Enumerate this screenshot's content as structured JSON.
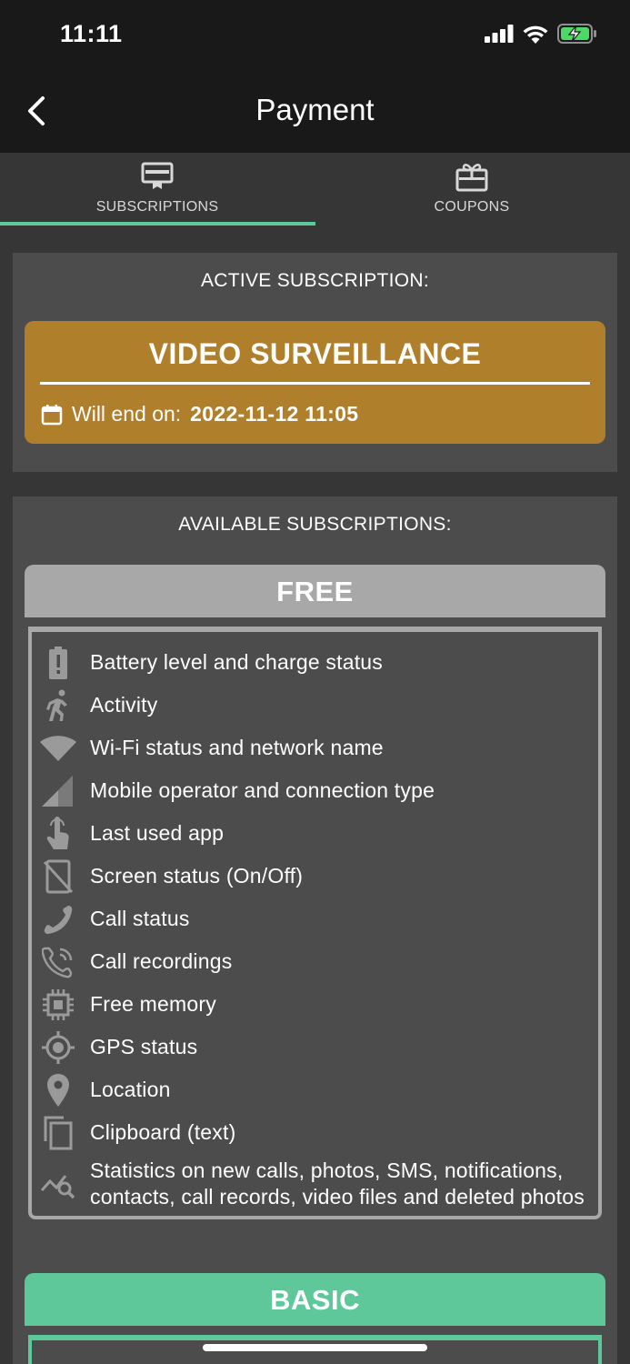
{
  "status_bar": {
    "time": "11:11"
  },
  "nav": {
    "title": "Payment"
  },
  "tabs": [
    {
      "label": "SUBSCRIPTIONS",
      "icon": "monitor-icon",
      "active": true
    },
    {
      "label": "COUPONS",
      "icon": "gift-icon",
      "active": false
    }
  ],
  "active_subscription": {
    "heading": "ACTIVE SUBSCRIPTION:",
    "plan_name": "VIDEO SURVEILLANCE",
    "end_label": "Will end on:",
    "end_value": "2022-11-12 11:05",
    "color": "#b07f2b"
  },
  "available": {
    "heading": "AVAILABLE SUBSCRIPTIONS:",
    "plans": [
      {
        "name": "FREE",
        "color": "#a8a8a8",
        "features": [
          {
            "icon": "battery-alert-icon",
            "label": "Battery level and charge status"
          },
          {
            "icon": "running-person-icon",
            "label": "Activity"
          },
          {
            "icon": "wifi-icon",
            "label": "Wi-Fi status and network name"
          },
          {
            "icon": "signal-icon",
            "label": "Mobile operator and connection type"
          },
          {
            "icon": "touch-hand-icon",
            "label": "Last used app"
          },
          {
            "icon": "screen-off-icon",
            "label": "Screen status (On/Off)"
          },
          {
            "icon": "phone-icon",
            "label": "Call status"
          },
          {
            "icon": "phone-recording-icon",
            "label": "Call recordings"
          },
          {
            "icon": "memory-chip-icon",
            "label": "Free memory"
          },
          {
            "icon": "gps-crosshair-icon",
            "label": "GPS status"
          },
          {
            "icon": "location-pin-icon",
            "label": "Location"
          },
          {
            "icon": "clipboard-copy-icon",
            "label": "Clipboard (text)"
          },
          {
            "icon": "stats-search-icon",
            "label": "Statistics on new calls, photos, SMS, notifications, contacts, call records, video files and deleted photos"
          }
        ]
      },
      {
        "name": "BASIC",
        "color": "#5ec89a"
      }
    ]
  }
}
